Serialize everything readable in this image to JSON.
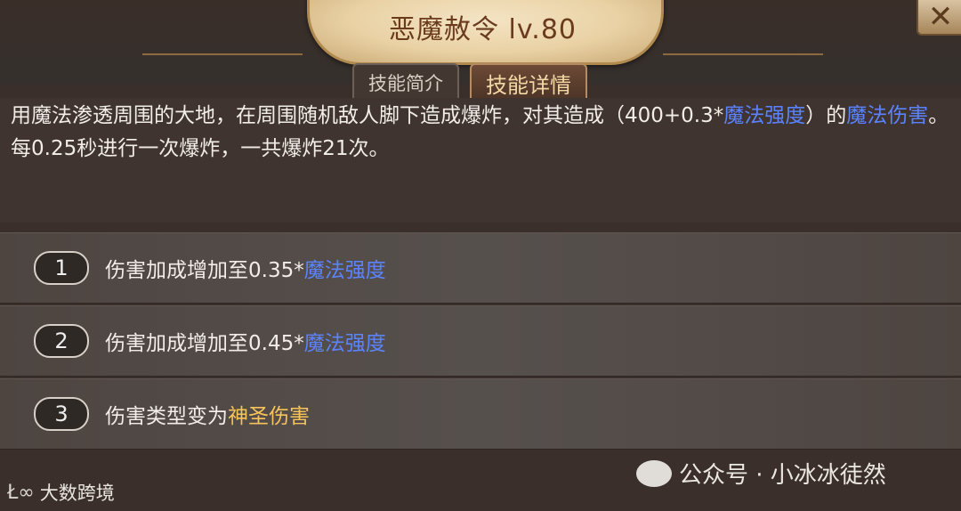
{
  "header": {
    "title": "恶魔赦令 lv.80",
    "close_symbol": "✕"
  },
  "tabs": [
    {
      "label": "技能简介",
      "active": false
    },
    {
      "label": "技能详情",
      "active": true
    }
  ],
  "description": {
    "p1": "用魔法渗透周围的大地，在周围随机敌人脚下造成爆炸，对其造成（400+0.3*",
    "p2": "魔法强度",
    "p3": "）的",
    "p4": "魔法伤害",
    "p5": "。每0.25秒进行一次爆炸，一共爆炸21次。"
  },
  "upgrades": [
    {
      "num": "1",
      "text": "伤害加成增加至0.35*",
      "highlight": "魔法强度",
      "highlight_color": "#5b83ff"
    },
    {
      "num": "2",
      "text": "伤害加成增加至0.45*",
      "highlight": "魔法强度",
      "highlight_color": "#5b83ff"
    },
    {
      "num": "3",
      "text": "伤害类型变为",
      "highlight": "神圣伤害",
      "highlight_color": "#f7c35a"
    }
  ],
  "watermarks": {
    "right": "公众号 · 小冰冰徒然",
    "left": "大数跨境",
    "left_logo": "Ł∞"
  }
}
